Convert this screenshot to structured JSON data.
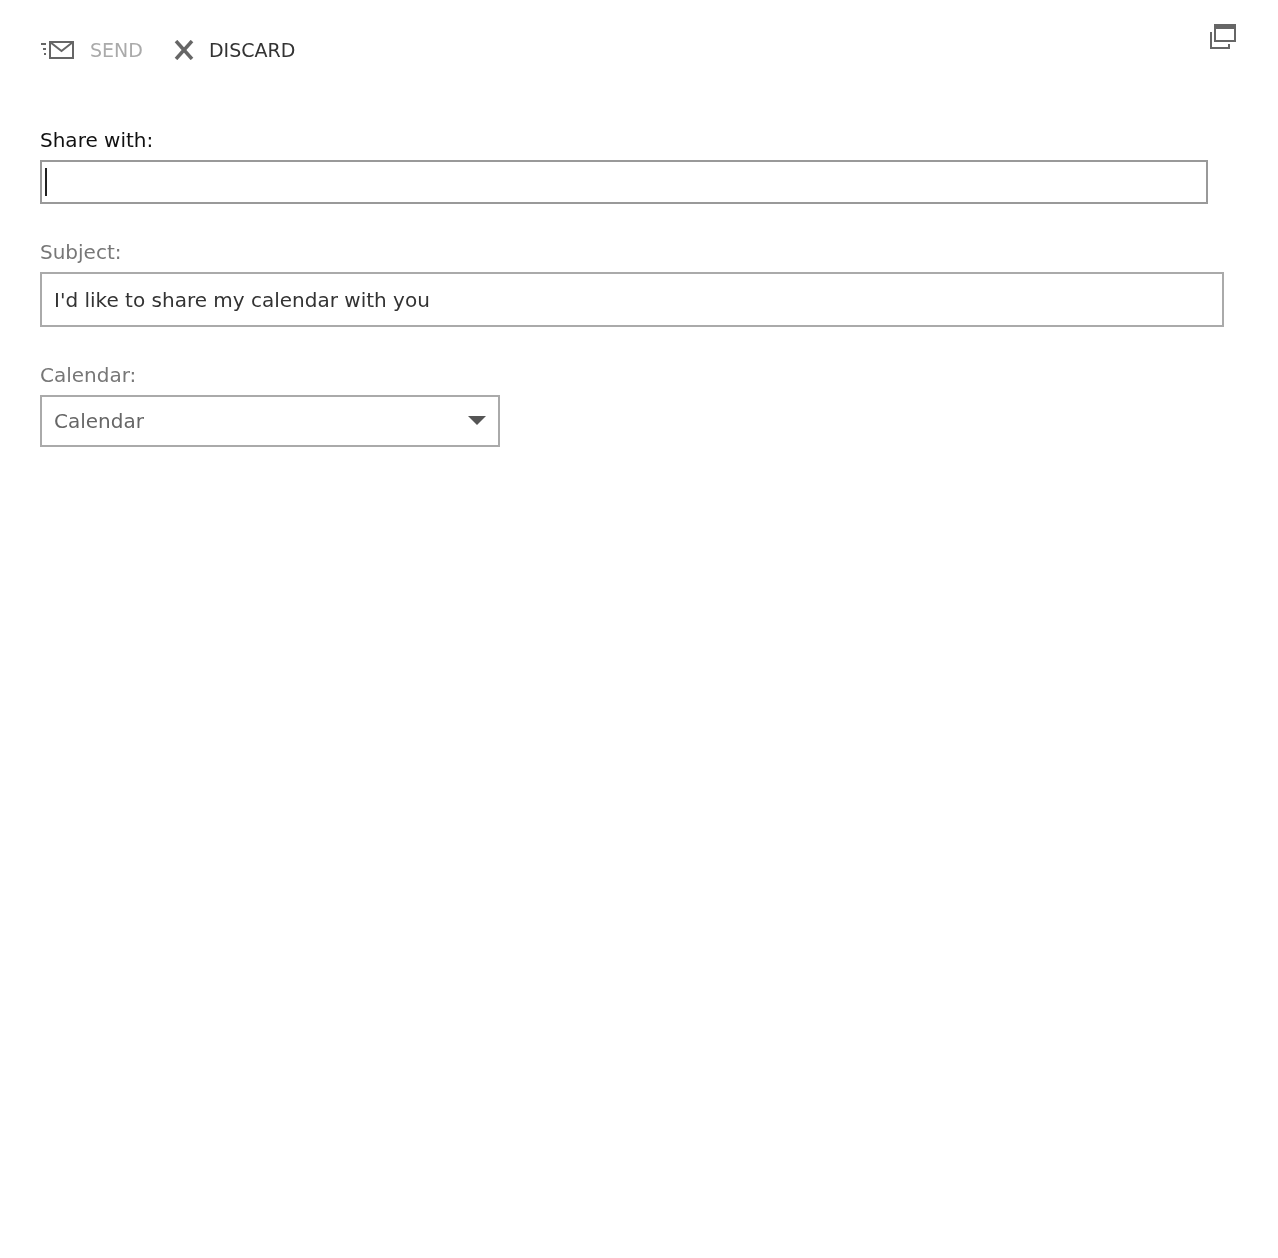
{
  "toolbar": [
    {
      "kind": "send",
      "label": "SEND",
      "disabled": true
    },
    {
      "kind": "discard",
      "label": "DISCARD",
      "disabled": false
    }
  ],
  "fields": [
    {
      "kind": "text",
      "label": "Share with:",
      "focused": true
    },
    {
      "kind": "text",
      "label": "Subject:",
      "value": "I'd like to share my calendar with you",
      "focused": false
    },
    {
      "kind": "select",
      "label": "Calendar:",
      "value": "Calendar",
      "focused": false
    }
  ]
}
